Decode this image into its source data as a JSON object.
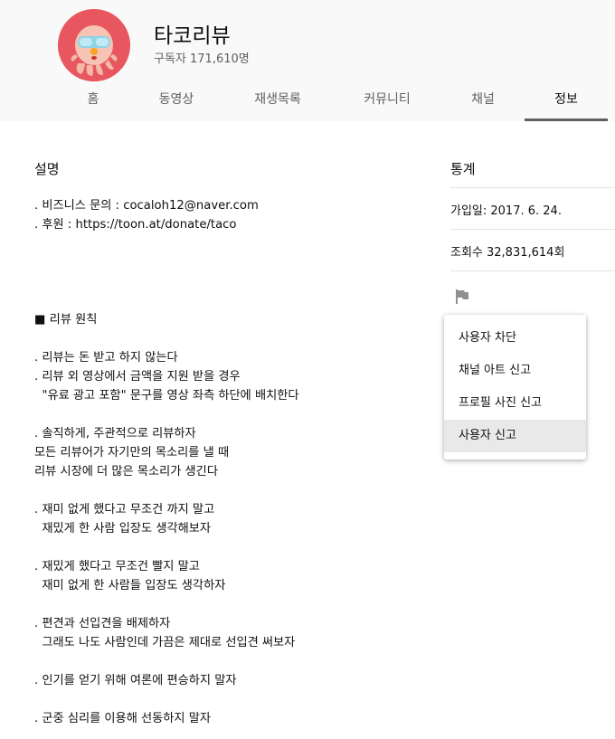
{
  "channel": {
    "name": "타코리뷰",
    "subscribers": "구독자 171,610명"
  },
  "tabs": [
    {
      "label": "홈",
      "active": false
    },
    {
      "label": "동영상",
      "active": false
    },
    {
      "label": "재생목록",
      "active": false
    },
    {
      "label": "커뮤니티",
      "active": false
    },
    {
      "label": "채널",
      "active": false
    },
    {
      "label": "정보",
      "active": true
    }
  ],
  "about": {
    "description_title": "설명",
    "description": ". 비즈니스 문의 : cocaloh12@naver.com\n. 후원 : https://toon.at/donate/taco\n\n\n\n\n■ 리뷰 원칙\n\n. 리뷰는 돈 받고 하지 않는다\n. 리뷰 외 영상에서 금액을 지원 받을 경우\n  \"유료 광고 포함\" 문구를 영상 좌측 하단에 배치한다\n\n. 솔직하게, 주관적으로 리뷰하자\n모든 리뷰어가 자기만의 목소리를 낼 때\n리뷰 시장에 더 많은 목소리가 생긴다\n\n. 재미 없게 했다고 무조건 까지 말고\n  재밌게 한 사람 입장도 생각해보자\n\n. 재밌게 했다고 무조건 빨지 말고\n  재미 없게 한 사람들 입장도 생각하자\n\n. 편견과 선입견을 배제하자\n  그래도 나도 사람인데 가끔은 제대로 선입견 써보자\n\n. 인기를 얻기 위해 여론에 편승하지 말자\n\n. 군중 심리를 이용해 선동하지 말자",
    "stats_title": "통계",
    "joined": "가입일: 2017. 6. 24.",
    "views": "조회수 32,831,614회"
  },
  "report_menu": {
    "items": [
      {
        "label": "사용자 차단",
        "highlighted": false
      },
      {
        "label": "채널 아트 신고",
        "highlighted": false
      },
      {
        "label": "프로필 사진 신고",
        "highlighted": false
      },
      {
        "label": "사용자 신고",
        "highlighted": true
      }
    ]
  },
  "icons": {
    "avatar": "octopus-mascot-avatar",
    "report": "flag-icon"
  },
  "colors": {
    "avatar_background": "#e8575f",
    "header_background": "#f9f9f9",
    "active_tab_underline": "#606060",
    "menu_highlight": "#e9e9e9"
  }
}
